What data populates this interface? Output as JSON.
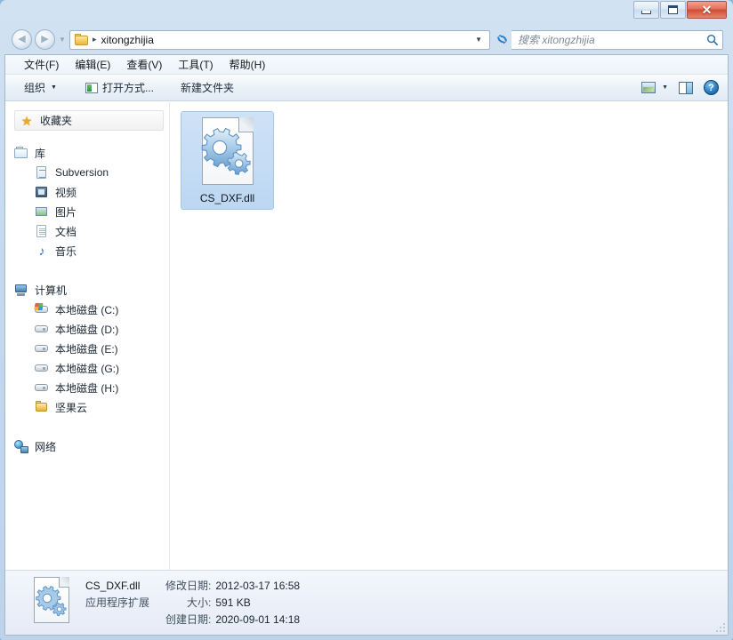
{
  "window": {
    "controls": {
      "minimize": "–",
      "maximize": "□",
      "close": "✕"
    }
  },
  "addressbar": {
    "folder_icon": "folder-icon",
    "separator": "▸",
    "crumb": "xitongzhijia",
    "dropdown": "▼",
    "refresh_icon": "refresh-icon"
  },
  "search": {
    "placeholder": "搜索 xitongzhijia",
    "icon": "search-icon"
  },
  "menubar": {
    "items": [
      {
        "label": "文件(F)"
      },
      {
        "label": "编辑(E)"
      },
      {
        "label": "查看(V)"
      },
      {
        "label": "工具(T)"
      },
      {
        "label": "帮助(H)"
      }
    ]
  },
  "toolbar": {
    "organize": "组织",
    "organize_caret": "▼",
    "open_with": "打开方式...",
    "new_folder": "新建文件夹",
    "view_caret": "▼",
    "help_glyph": "?"
  },
  "navpane": {
    "favorites": {
      "label": "收藏夹",
      "icon": "star-icon"
    },
    "library": {
      "label": "库",
      "icon": "library-icon"
    },
    "library_items": [
      {
        "label": "Subversion",
        "icon": "subversion-icon"
      },
      {
        "label": "视频",
        "icon": "video-icon"
      },
      {
        "label": "图片",
        "icon": "picture-icon"
      },
      {
        "label": "文档",
        "icon": "document-icon"
      },
      {
        "label": "音乐",
        "icon": "music-icon"
      }
    ],
    "computer": {
      "label": "计算机",
      "icon": "computer-icon"
    },
    "computer_items": [
      {
        "label": "本地磁盘 (C:)",
        "icon": "system-drive-icon"
      },
      {
        "label": "本地磁盘 (D:)",
        "icon": "drive-icon"
      },
      {
        "label": "本地磁盘 (E:)",
        "icon": "drive-icon"
      },
      {
        "label": "本地磁盘 (G:)",
        "icon": "drive-icon"
      },
      {
        "label": "本地磁盘 (H:)",
        "icon": "drive-icon"
      },
      {
        "label": "坚果云",
        "icon": "folder-icon"
      }
    ],
    "network": {
      "label": "网络",
      "icon": "network-icon"
    }
  },
  "content": {
    "files": [
      {
        "name": "CS_DXF.dll",
        "icon": "dll-gear-icon",
        "selected": true
      }
    ]
  },
  "statusbar": {
    "name": "CS_DXF.dll",
    "type": "应用程序扩展",
    "modified_key": "修改日期:",
    "modified_value": "2012-03-17 16:58",
    "size_key": "大小:",
    "size_value": "591 KB",
    "created_key": "创建日期:",
    "created_value": "2020-09-01 14:18"
  },
  "colors": {
    "selection": "#bcd7f2",
    "frame": "#bcd3ea",
    "close_button": "#cf4a33",
    "accent_link": "#1b2733"
  }
}
